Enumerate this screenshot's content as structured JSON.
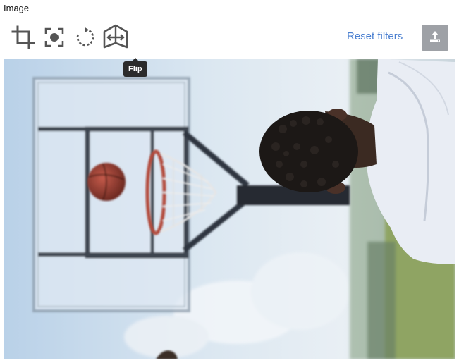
{
  "field": {
    "label": "Image"
  },
  "toolbar": {
    "tools": [
      {
        "name": "crop",
        "icon": "crop-icon"
      },
      {
        "name": "focus",
        "icon": "focus-point-icon"
      },
      {
        "name": "rotate",
        "icon": "rotate-icon"
      },
      {
        "name": "flip",
        "icon": "flip-icon"
      }
    ],
    "reset_label": "Reset filters",
    "upload_icon": "upload-icon"
  },
  "tooltip": {
    "text": "Flip"
  },
  "colors": {
    "accent_link": "#4a7fd0",
    "icon": "#555555",
    "upload_bg": "#9ea1a6",
    "tooltip_bg": "#2b2b2b"
  }
}
